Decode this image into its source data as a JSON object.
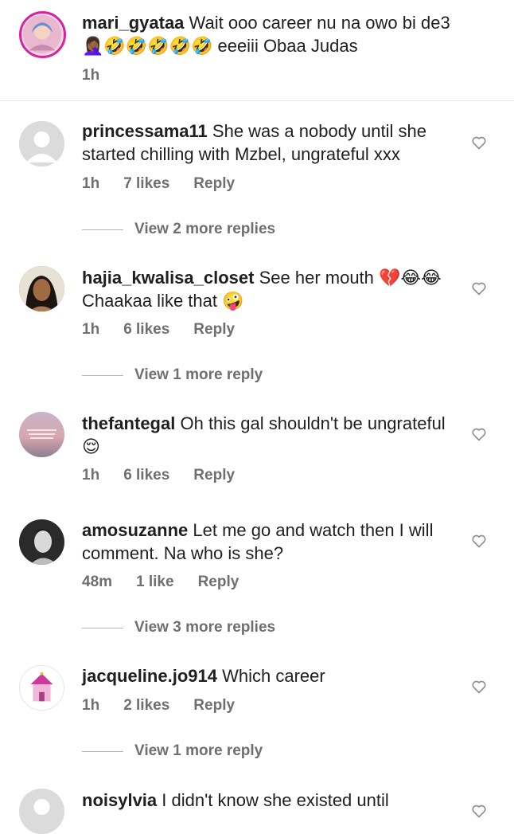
{
  "comments": [
    {
      "user": "mari_gyataa",
      "text": "Wait ooo career nu na owo bi de3 🤦🏾‍♀️🤣🤣🤣🤣🤣 eeeiii Obaa Judas",
      "time": "1h"
    },
    {
      "user": "princessama11",
      "text": "She was a nobody until she started chilling with Mzbel, ungrateful xxx",
      "time": "1h",
      "likes": "7 likes",
      "reply": "Reply",
      "view_replies": "View 2 more replies"
    },
    {
      "user": "hajia_kwalisa_closet",
      "text": "See her mouth 💔😂😂Chaakaa like that 🤪",
      "time": "1h",
      "likes": "6 likes",
      "reply": "Reply",
      "view_replies": "View 1 more reply"
    },
    {
      "user": "thefantegal",
      "text": "Oh this gal shouldn't be ungrateful 😌",
      "time": "1h",
      "likes": "6 likes",
      "reply": "Reply"
    },
    {
      "user": "amosuzanne",
      "text": "Let me go and watch then I will comment.  Na who is she?",
      "time": "48m",
      "likes": "1 like",
      "reply": "Reply",
      "view_replies": "View 3 more replies"
    },
    {
      "user": "jacqueline.jo914",
      "text": "Which career",
      "time": "1h",
      "likes": "2 likes",
      "reply": "Reply",
      "view_replies": "View 1 more reply"
    },
    {
      "user": "noisylvia",
      "text": "I didn't know she existed until"
    }
  ],
  "icons": {
    "like": "heart-outline-icon"
  }
}
